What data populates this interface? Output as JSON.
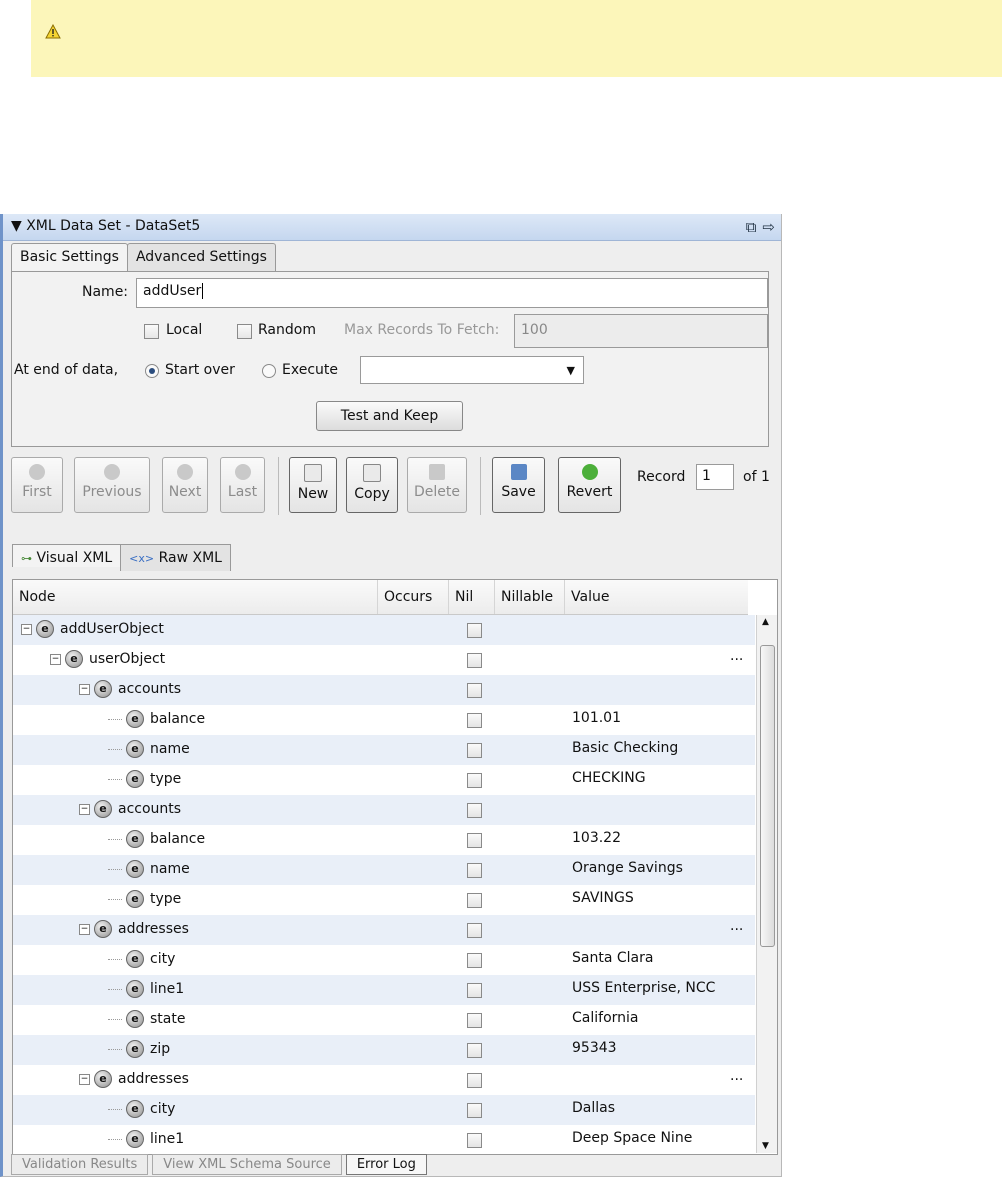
{
  "warning": {
    "icon": "warning-icon"
  },
  "panel": {
    "title": "XML Data Set - DataSet5",
    "tabs": [
      "Basic Settings",
      "Advanced Settings"
    ],
    "name_label": "Name:",
    "name_value": "addUser",
    "local_label": "Local",
    "random_label": "Random",
    "max_records_label": "Max Records To Fetch:",
    "max_records_value": "100",
    "end_label": "At end of data,",
    "start_over_label": "Start over",
    "execute_label": "Execute",
    "execute_value": "",
    "test_keep_label": "Test and Keep"
  },
  "toolbar": {
    "first": "First",
    "previous": "Previous",
    "next": "Next",
    "last": "Last",
    "new": "New",
    "copy": "Copy",
    "delete": "Delete",
    "save": "Save",
    "revert": "Revert",
    "record_label": "Record",
    "record_value": "1",
    "record_of": "of 1"
  },
  "xml_tabs": [
    "Visual XML",
    "Raw XML"
  ],
  "grid": {
    "headers": [
      "Node",
      "Occurs",
      "Nil",
      "Nillable",
      "Value"
    ],
    "rows": [
      {
        "name": "addUserObject",
        "value": "",
        "more": false
      },
      {
        "name": "userObject",
        "value": "",
        "more": true
      },
      {
        "name": "accounts",
        "value": "",
        "more": false
      },
      {
        "name": "balance",
        "value": "101.01",
        "more": false
      },
      {
        "name": "name",
        "value": "Basic Checking",
        "more": false
      },
      {
        "name": "type",
        "value": "CHECKING",
        "more": false
      },
      {
        "name": "accounts",
        "value": "",
        "more": false
      },
      {
        "name": "balance",
        "value": "103.22",
        "more": false
      },
      {
        "name": "name",
        "value": "Orange Savings",
        "more": false
      },
      {
        "name": "type",
        "value": "SAVINGS",
        "more": false
      },
      {
        "name": "addresses",
        "value": "",
        "more": true
      },
      {
        "name": "city",
        "value": "Santa Clara",
        "more": false
      },
      {
        "name": "line1",
        "value": "USS Enterprise, NCC",
        "more": false
      },
      {
        "name": "state",
        "value": "California",
        "more": false
      },
      {
        "name": "zip",
        "value": "95343",
        "more": false
      },
      {
        "name": "addresses",
        "value": "",
        "more": true
      },
      {
        "name": "city",
        "value": "Dallas",
        "more": false
      },
      {
        "name": "line1",
        "value": "Deep Space Nine",
        "more": false
      }
    ],
    "more_text": "..."
  },
  "bottom_tabs": [
    "Validation Results",
    "View XML Schema Source",
    "Error Log"
  ]
}
